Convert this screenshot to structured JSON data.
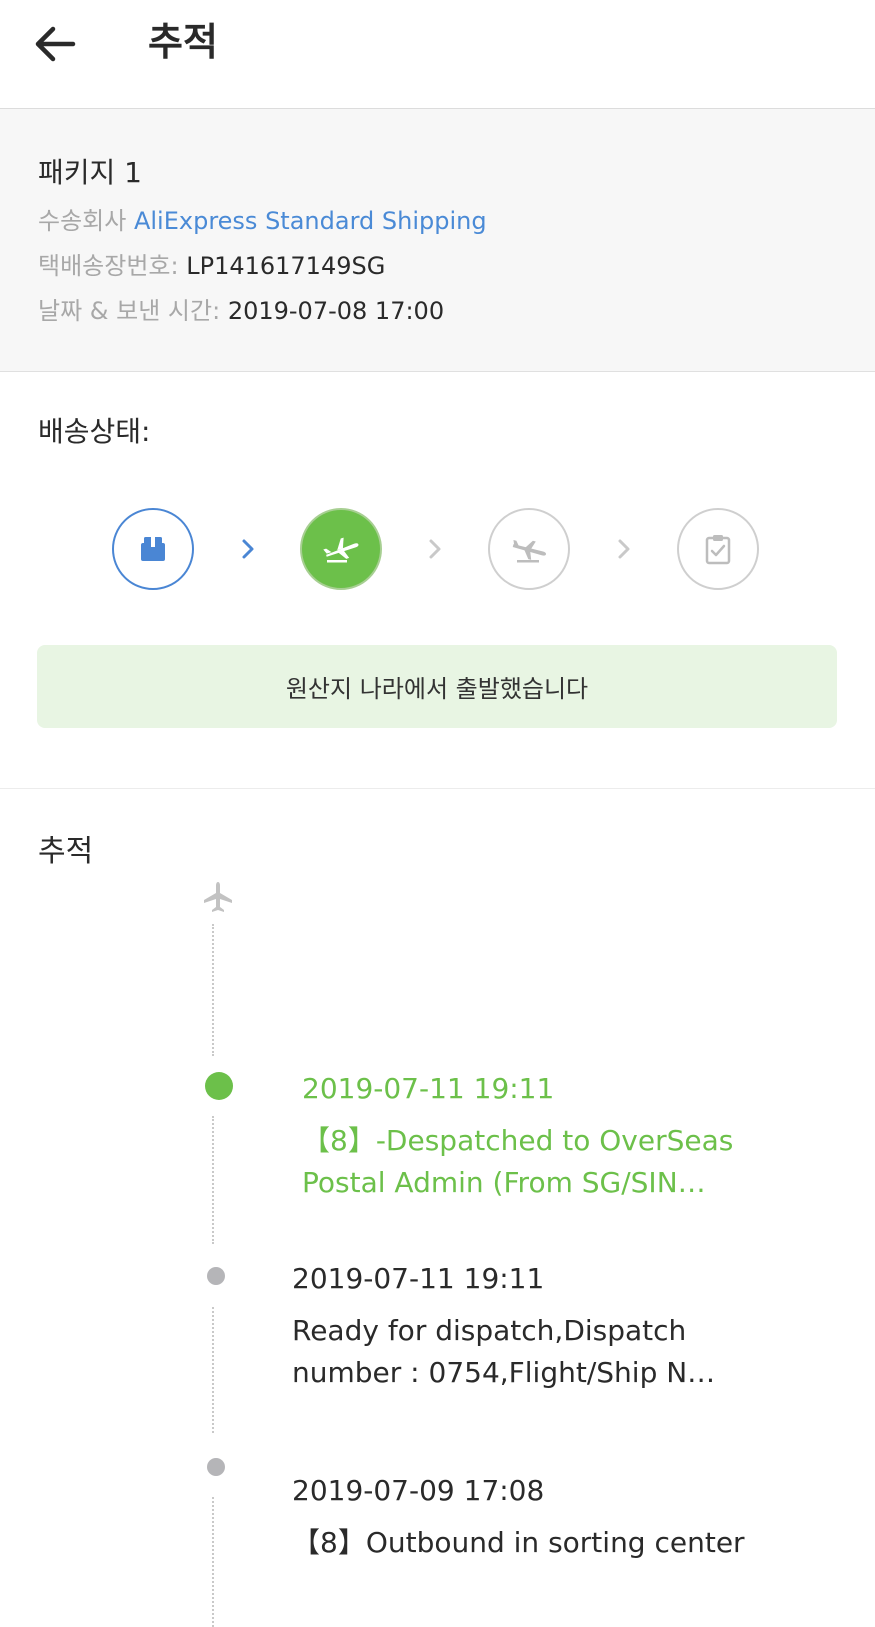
{
  "header": {
    "title": "추적",
    "back_icon": "arrow-left-icon"
  },
  "package": {
    "name": "패키지 1",
    "carrier_label": "수송회사",
    "carrier_value": "AliExpress Standard Shipping",
    "tracking_label": "택배송장번호:",
    "tracking_value": "LP141617149SG",
    "date_label": "날짜 & 보낸 시간:",
    "date_value": "2019-07-08 17:00"
  },
  "status": {
    "title": "배송상태:",
    "steps": [
      {
        "icon": "package-box-icon",
        "state": "done"
      },
      {
        "icon": "airplane-takeoff-icon",
        "state": "current"
      },
      {
        "icon": "airplane-landing-icon",
        "state": "todo"
      },
      {
        "icon": "clipboard-check-icon",
        "state": "todo"
      }
    ],
    "banner": "원산지 나라에서 출발했습니다"
  },
  "tracking": {
    "title": "추적",
    "events": [
      {
        "date": "2019-07-11 19:11",
        "desc": "【8】-Despatched to OverSeas Postal Admin (From SG/SIN…",
        "active": true
      },
      {
        "date": "2019-07-11 19:11",
        "desc": "Ready for dispatch,Dispatch number : 0754,Flight/Ship N…",
        "active": false
      },
      {
        "date": "2019-07-09 17:08",
        "desc": "【8】Outbound in sorting center",
        "active": false
      }
    ]
  },
  "colors": {
    "accent_blue": "#4a86d4",
    "accent_green": "#6cc04a",
    "banner_bg": "#e8f5e3"
  }
}
